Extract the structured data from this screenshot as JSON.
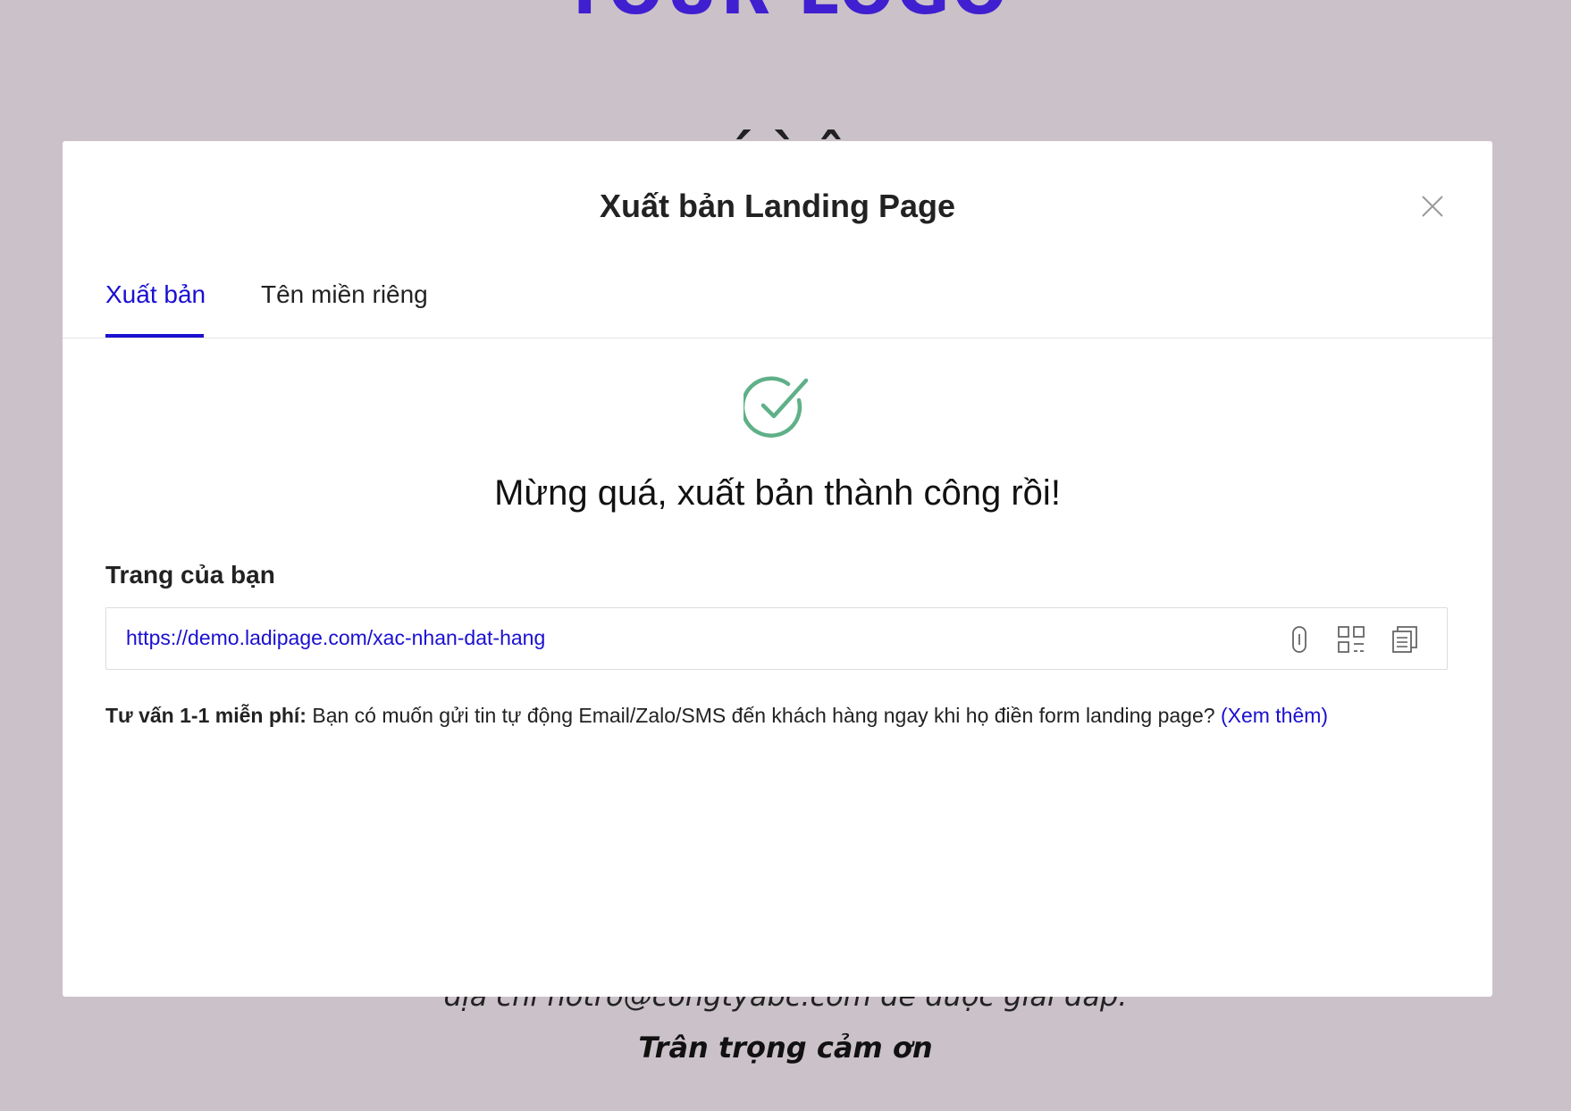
{
  "background": {
    "logo_text": "YOUR LOGO",
    "heading_partial": "ˊ      ˋ     ˆ",
    "contact_line": "địa chỉ hotro@congtyabc.com để được giải đáp.",
    "thanks": "Trân trọng cảm ơn"
  },
  "modal": {
    "title": "Xuất bản Landing Page",
    "close_icon": "close-icon",
    "tabs": [
      {
        "label": "Xuất bản",
        "active": true
      },
      {
        "label": "Tên miền riêng",
        "active": false
      }
    ],
    "success_icon": "check-circle-icon",
    "success_message": "Mừng quá, xuất bản thành công rồi!",
    "page_label": "Trang của bạn",
    "url": "https://demo.ladipage.com/xac-nhan-dat-hang",
    "url_actions": [
      "link-icon",
      "qr-code-icon",
      "copy-icon"
    ],
    "advice": {
      "bold": "Tư vấn 1-1 miễn phí:",
      "text": " Bạn có muốn gửi tin tự động Email/Zalo/SMS đến khách hàng ngay khi họ điền form landing page? ",
      "link": "(Xem thêm)"
    }
  },
  "colors": {
    "accent": "#1a0fd1",
    "success": "#5fb088",
    "overlay_bg": "#cbc1c8"
  }
}
